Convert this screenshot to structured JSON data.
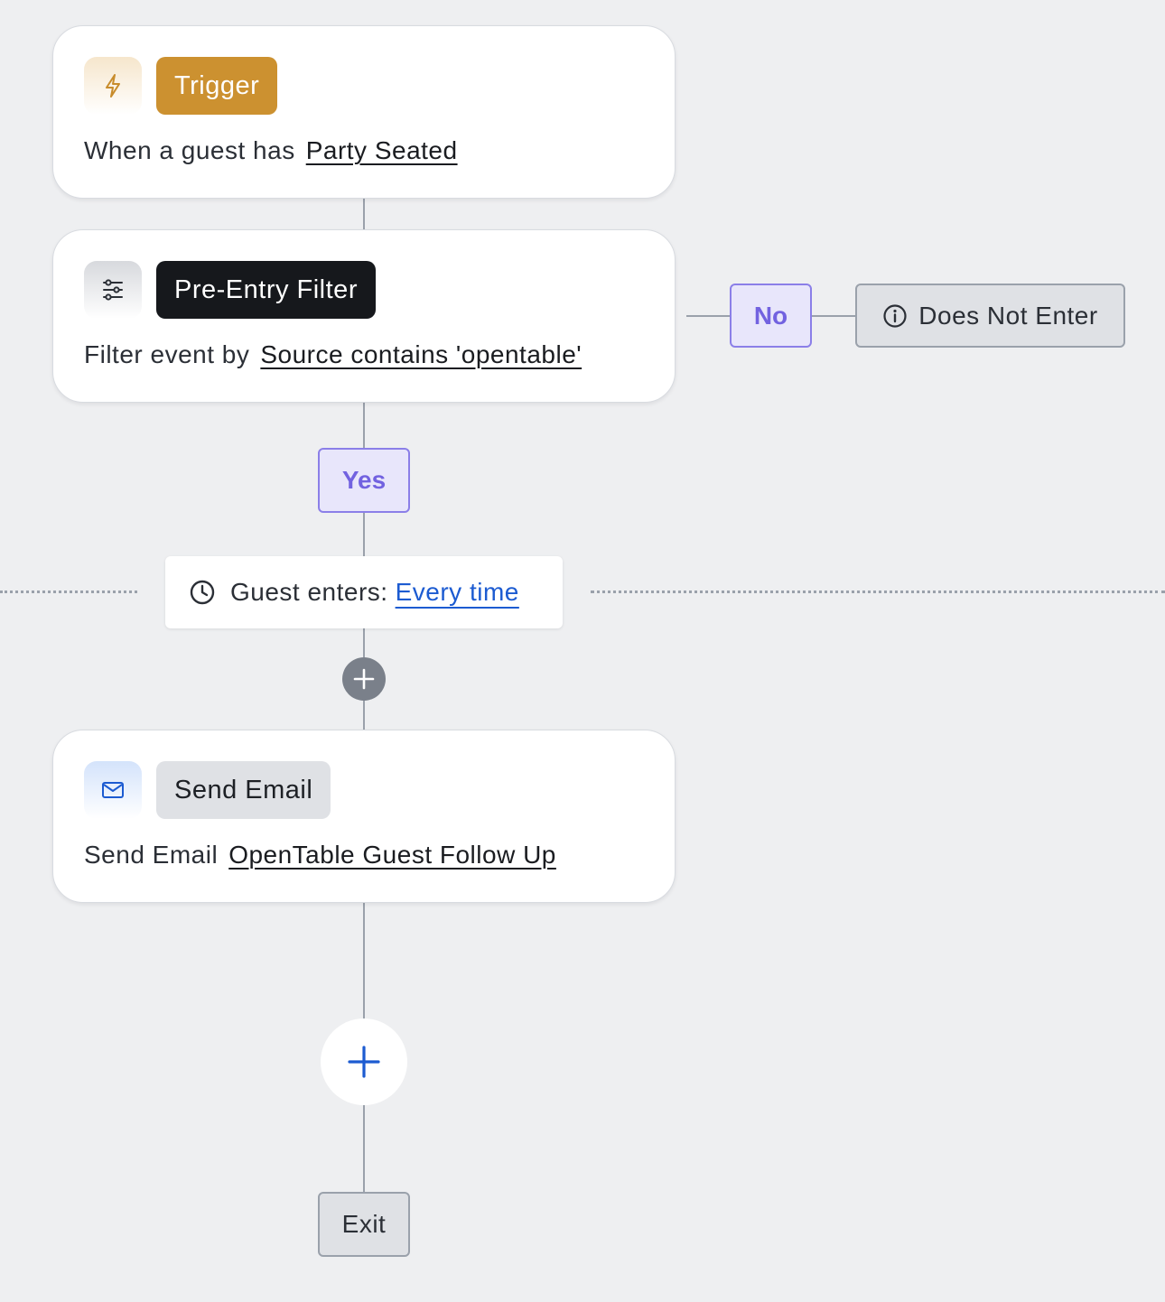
{
  "trigger": {
    "icon": "lightning-icon",
    "badge": "Trigger",
    "desc_prefix": "When a guest has",
    "desc_link": "Party Seated"
  },
  "filter": {
    "icon": "sliders-icon",
    "badge": "Pre-Entry Filter",
    "desc_prefix": "Filter event by",
    "desc_link": "Source contains 'opentable'"
  },
  "branches": {
    "no_label": "No",
    "does_not_enter_label": "Does Not Enter",
    "yes_label": "Yes"
  },
  "entry": {
    "label": "Guest enters:",
    "value": "Every time"
  },
  "email": {
    "icon": "mail-icon",
    "badge": "Send Email",
    "desc_prefix": "Send Email",
    "desc_link": "OpenTable Guest Follow Up"
  },
  "exit_label": "Exit",
  "colors": {
    "background": "#eeeff1",
    "trigger_badge": "#cc9130",
    "filter_badge": "#16181c",
    "email_badge": "#dfe1e5",
    "branch_accent": "#7262e0",
    "link_blue": "#1c5bd1"
  }
}
